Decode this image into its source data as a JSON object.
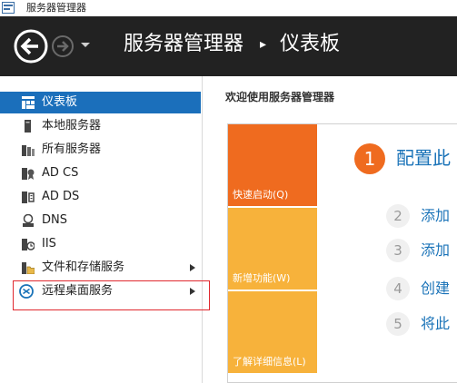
{
  "window": {
    "title": "服务器管理器"
  },
  "header": {
    "app_name": "服务器管理器",
    "separator": "▸",
    "page": "仪表板"
  },
  "sidebar": {
    "items": [
      {
        "label": "仪表板",
        "icon": "dashboard-icon",
        "active": true
      },
      {
        "label": "本地服务器",
        "icon": "server-icon"
      },
      {
        "label": "所有服务器",
        "icon": "servers-icon"
      },
      {
        "label": "AD CS",
        "icon": "certificate-icon"
      },
      {
        "label": "AD DS",
        "icon": "directory-icon"
      },
      {
        "label": "DNS",
        "icon": "dns-icon"
      },
      {
        "label": "IIS",
        "icon": "iis-icon"
      },
      {
        "label": "文件和存储服务",
        "icon": "file-storage-icon",
        "has_submenu": true
      },
      {
        "label": "远程桌面服务",
        "icon": "remote-desktop-icon",
        "has_submenu": true,
        "highlighted": true
      }
    ]
  },
  "welcome": {
    "title": "欢迎使用服务器管理器",
    "tiles": [
      {
        "label": "快速启动(Q)",
        "color": "#ef6b1f"
      },
      {
        "label": "新增功能(W)",
        "color": "#f7b23b"
      },
      {
        "label": "了解详细信息(L)",
        "color": "#f7b23b"
      }
    ],
    "steps": [
      {
        "num": "1",
        "text": "配置此"
      },
      {
        "num": "2",
        "text": "添加"
      },
      {
        "num": "3",
        "text": "添加"
      },
      {
        "num": "4",
        "text": "创建"
      },
      {
        "num": "5",
        "text": "将此"
      }
    ]
  },
  "colors": {
    "header_bg": "#222222",
    "accent": "#1b6fbb",
    "link": "#1a73b8",
    "highlight_border": "#e0282e"
  }
}
